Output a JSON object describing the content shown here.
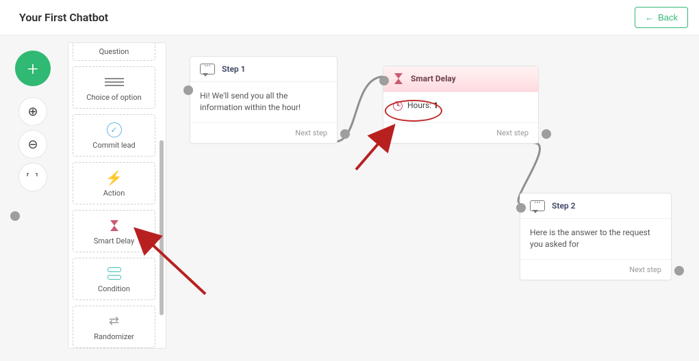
{
  "header": {
    "title": "Your First Chatbot",
    "back_label": "Back"
  },
  "palette": {
    "items": [
      {
        "label": "Question"
      },
      {
        "label": "Choice of option"
      },
      {
        "label": "Commit lead"
      },
      {
        "label": "Action"
      },
      {
        "label": "Smart Delay"
      },
      {
        "label": "Condition"
      },
      {
        "label": "Randomizer"
      }
    ]
  },
  "cards": {
    "step1": {
      "title": "Step 1",
      "body": "Hi! We'll send you all the information within the hour!",
      "next_label": "Next step"
    },
    "smart": {
      "title": "Smart Delay",
      "hours_label": "Hours:",
      "hours_value": "1",
      "next_label": "Next step"
    },
    "step2": {
      "title": "Step 2",
      "body": "Here is the answer to the request you asked for",
      "next_label": "Next step"
    }
  }
}
